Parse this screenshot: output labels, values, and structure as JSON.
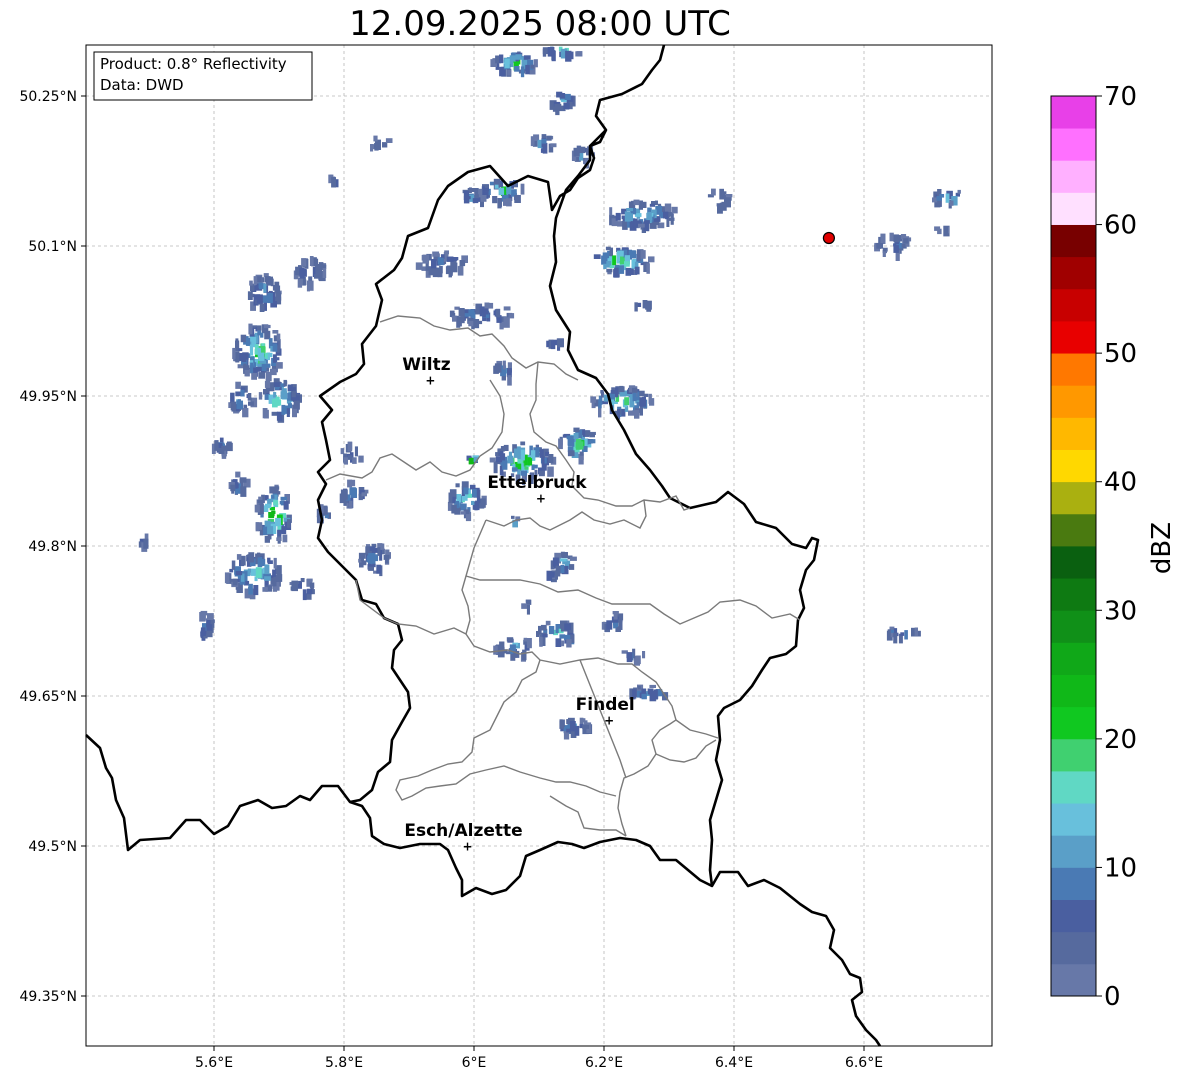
{
  "title": "12.09.2025 08:00 UTC",
  "info_box": {
    "product": "Product: 0.8° Reflectivity",
    "source": "Data: DWD"
  },
  "lat_ticks": [
    "50.25°N",
    "50.1°N",
    "49.95°N",
    "49.8°N",
    "49.65°N",
    "49.5°N",
    "49.35°N"
  ],
  "lon_ticks": [
    "5.6°E",
    "5.8°E",
    "6°E",
    "6.2°E",
    "6.4°E",
    "6.6°E"
  ],
  "cities": [
    {
      "name": "Wiltz",
      "lon": 5.933,
      "lat": 49.966
    },
    {
      "name": "Ettelbruck",
      "lon": 6.103,
      "lat": 49.848
    },
    {
      "name": "Findel",
      "lon": 6.208,
      "lat": 49.626
    },
    {
      "name": "Esch/Alzette",
      "lon": 5.99,
      "lat": 49.5
    }
  ],
  "marker": {
    "lon": 6.546,
    "lat": 50.108,
    "color": "#e00000"
  },
  "colorbar": {
    "label": "dBZ",
    "ticks": [
      "0",
      "10",
      "20",
      "30",
      "40",
      "50",
      "60",
      "70"
    ],
    "colors": [
      "#6778a8",
      "#566a9e",
      "#4a5fa0",
      "#4a7ab4",
      "#5a9fc8",
      "#68c0dc",
      "#60d8c4",
      "#40d070",
      "#10c820",
      "#10b818",
      "#10a818",
      "#109018",
      "#0e7a12",
      "#0a6010",
      "#4a7a10",
      "#aab010",
      "#ffd800",
      "#ffb800",
      "#ff9800",
      "#ff7800",
      "#e80000",
      "#c80000",
      "#a00000",
      "#780000",
      "#ffe0ff",
      "#ffb0ff",
      "#ff70ff",
      "#e840e8"
    ]
  }
}
